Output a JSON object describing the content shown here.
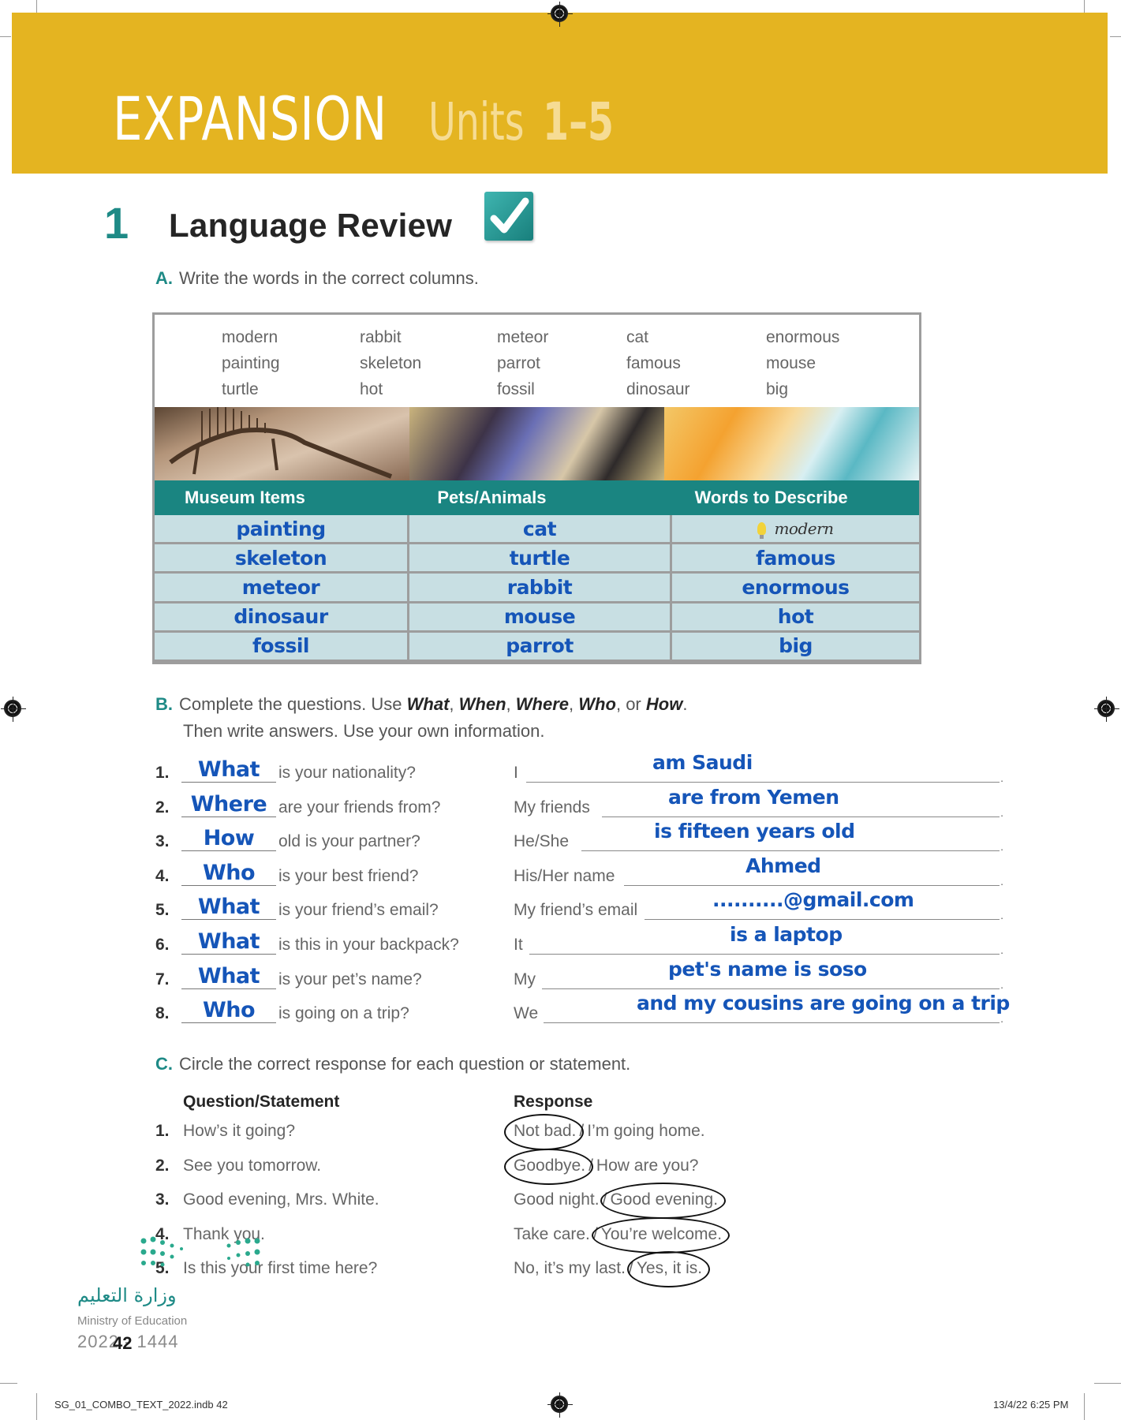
{
  "header": {
    "title_main": "EXPANSION",
    "title_units": "Units",
    "title_range": "1–5",
    "band_color": "#e4b421"
  },
  "section": {
    "number": "1",
    "title": "Language Review",
    "icon": "checkmark-icon",
    "accent_color": "#1e8a86"
  },
  "part_a": {
    "letter": "A.",
    "instruction": "Write the words in the correct columns.",
    "word_bank": [
      [
        "modern",
        "painting",
        "turtle"
      ],
      [
        "rabbit",
        "skeleton",
        "hot"
      ],
      [
        "meteor",
        "parrot",
        "fossil"
      ],
      [
        "cat",
        "famous",
        "dinosaur"
      ],
      [
        "enormous",
        "mouse",
        "big"
      ]
    ],
    "columns": [
      "Museum Items",
      "Pets/Animals",
      "Words to Describe"
    ],
    "rows": [
      [
        "painting",
        "cat",
        "modern"
      ],
      [
        "skeleton",
        "turtle",
        "famous"
      ],
      [
        "meteor",
        "rabbit",
        "enormous"
      ],
      [
        "dinosaur",
        "mouse",
        "hot"
      ],
      [
        "fossil",
        "parrot",
        "big"
      ]
    ],
    "answer_color": "#1555b8"
  },
  "part_b": {
    "letter": "B.",
    "instruction_pre": "Complete the questions. Use",
    "keywords": [
      "What",
      "When",
      "Where",
      "Who",
      "How"
    ],
    "sep1": ",",
    "or": "or",
    "period": ".",
    "instruction_2": "Then write answers. Use your own information.",
    "items": [
      {
        "num": "1.",
        "answer": "What",
        "question": "is your nationality?",
        "prefix": "I",
        "response": "am Saudi"
      },
      {
        "num": "2.",
        "answer": "Where",
        "question": "are your friends from?",
        "prefix": "My friends",
        "response": "are from Yemen"
      },
      {
        "num": "3.",
        "answer": "How",
        "question": "old is your partner?",
        "prefix": "He/She",
        "response": "is fifteen years old"
      },
      {
        "num": "4.",
        "answer": "Who",
        "question": "is your best friend?",
        "prefix": "His/Her name",
        "response": "Ahmed"
      },
      {
        "num": "5.",
        "answer": "What",
        "question": "is your friend’s email?",
        "prefix": "My friend’s email",
        "response": "..........@gmail.com"
      },
      {
        "num": "6.",
        "answer": "What",
        "question": "is this in your backpack?",
        "prefix": "It",
        "response": "is a laptop"
      },
      {
        "num": "7.",
        "answer": "What",
        "question": "is your pet’s name?",
        "prefix": "My",
        "response": "pet's name is soso"
      },
      {
        "num": "8.",
        "answer": "Who",
        "question": "is going on a trip?",
        "prefix": "We",
        "response": "and my cousins are going on a trip"
      }
    ]
  },
  "part_c": {
    "letter": "C.",
    "instruction": "Circle the correct response for each question or statement.",
    "col_question": "Question/Statement",
    "col_response": "Response",
    "items": [
      {
        "num": "1.",
        "question": "How’s it going?",
        "options": [
          "Not bad.",
          "I’m going home."
        ],
        "circled": 0
      },
      {
        "num": "2.",
        "question": "See you tomorrow.",
        "options": [
          "Goodbye.",
          "How are you?"
        ],
        "circled": 0
      },
      {
        "num": "3.",
        "question": "Good evening, Mrs. White.",
        "options": [
          "Good night.",
          "Good evening."
        ],
        "circled": 1
      },
      {
        "num": "4.",
        "question": "Thank you.",
        "options": [
          "Take care.",
          "You’re welcome."
        ],
        "circled": 1
      },
      {
        "num": "5.",
        "question": "Is this your first time here?",
        "options": [
          "No, it’s my last.",
          "Yes, it is."
        ],
        "circled": 1
      }
    ],
    "separator": "/"
  },
  "footer": {
    "ministry_ar": "وزارة التعليم",
    "ministry_en": "Ministry of Education",
    "year": "2022 - 1444",
    "page_number": "42",
    "slug": "SG_01_COMBO_TEXT_2022.indb   42",
    "timestamp": "13/4/22   6:25 PM"
  }
}
